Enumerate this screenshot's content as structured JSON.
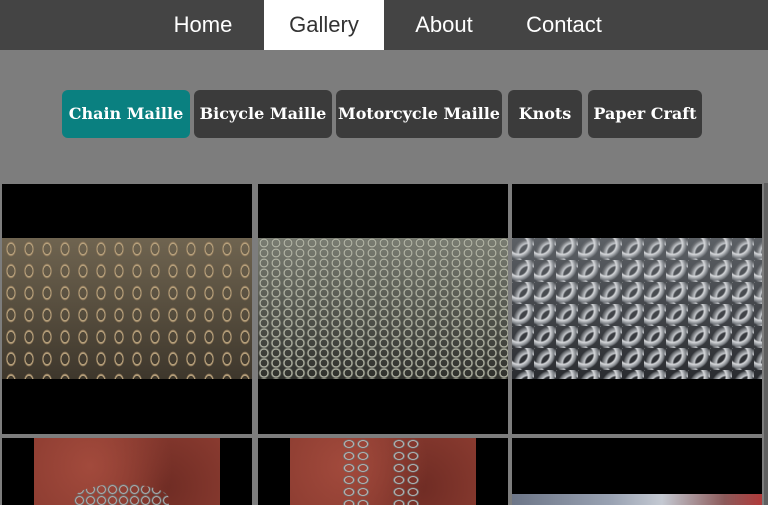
{
  "nav": {
    "items": [
      {
        "label": "Home",
        "active": false
      },
      {
        "label": "Gallery",
        "active": true
      },
      {
        "label": "About",
        "active": false
      },
      {
        "label": "Contact",
        "active": false
      }
    ]
  },
  "filters": {
    "items": [
      {
        "label": "Chain Maille",
        "active": true
      },
      {
        "label": "Bicycle Maille",
        "active": false
      },
      {
        "label": "Motorcycle Maille",
        "active": false
      },
      {
        "label": "Knots",
        "active": false
      },
      {
        "label": "Paper Craft",
        "active": false
      }
    ]
  },
  "colors": {
    "nav_bg": "#444444",
    "nav_active_bg": "#ffffff",
    "page_bg": "#7d7d7d",
    "filter_bg": "#3b3b3b",
    "filter_active_bg": "#0a8080"
  },
  "gallery": {
    "images": [
      {
        "subject": "chain-maille-4in1-brass"
      },
      {
        "subject": "chain-maille-european-weave"
      },
      {
        "subject": "chain-maille-japanese-weave"
      },
      {
        "subject": "chain-maille-rosette-on-red"
      },
      {
        "subject": "chain-maille-chains-on-red"
      },
      {
        "subject": "chain-maille-partial-photo"
      }
    ]
  }
}
